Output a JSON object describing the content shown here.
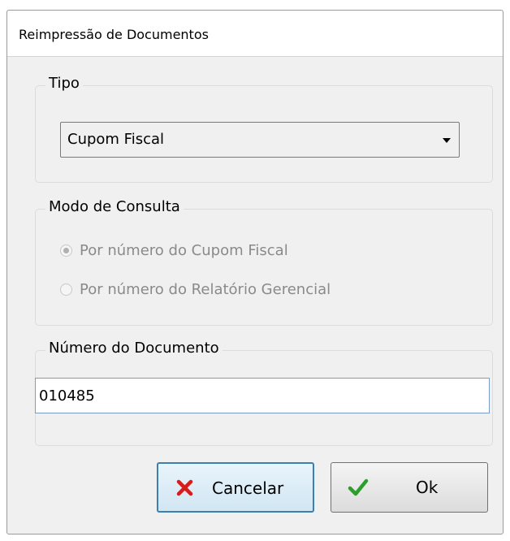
{
  "window": {
    "title": "Reimpressão de Documentos"
  },
  "tipo": {
    "legend": "Tipo",
    "selected": "Cupom Fiscal"
  },
  "modo": {
    "legend": "Modo de Consulta",
    "options": [
      {
        "label": "Por número do Cupom Fiscal",
        "checked": true
      },
      {
        "label": "Por número do Relatório Gerencial",
        "checked": false
      }
    ]
  },
  "numero": {
    "legend": "Número do Documento",
    "value": "010485"
  },
  "buttons": {
    "cancel": "Cancelar",
    "ok": "Ok"
  },
  "colors": {
    "cancel_icon": "#d81b1b",
    "ok_icon": "#2aa02a"
  },
  "icons": {
    "cancel": "close-icon",
    "ok": "check-icon"
  }
}
